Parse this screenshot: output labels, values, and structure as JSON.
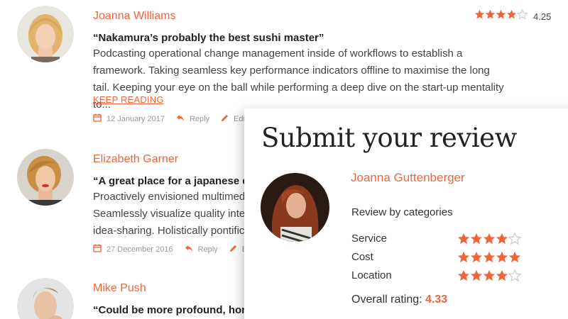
{
  "reviews": [
    {
      "name": "Joanna Williams",
      "quote": "“Nakamura’s probably the best sushi master”",
      "body": "Podcasting operational change management inside of workflows to establish a framework. Taking seamless key performance indicators offline to maximise the long tail. Keeping your eye on the ball while performing a deep dive on the start-up mentality to...",
      "keep_reading": "KEEP READING",
      "date": "12 January 2017",
      "reply": "Reply",
      "edit": "Edit",
      "rating": 4,
      "rating_label": "4.25"
    },
    {
      "name": "Elizabeth Garner",
      "quote": "“A great place for a japanese din",
      "body": "Proactively envisioned multimedia Seamlessly visualize quality intelle idea-sharing. Holistically pontifica",
      "date": "27 December 2016",
      "reply": "Reply",
      "edit": "E"
    },
    {
      "name": "Mike Push",
      "quote": "“Could be more profound, honest"
    }
  ],
  "submit": {
    "title": "Submit your review",
    "name": "Joanna Guttenberger",
    "categories_label": "Review by categories",
    "categories": [
      {
        "label": "Service",
        "stars": 4
      },
      {
        "label": "Cost",
        "stars": 5
      },
      {
        "label": "Location",
        "stars": 4
      }
    ],
    "overall_label": "Overall rating:",
    "overall_value": "4.33"
  },
  "colors": {
    "accent": "#f0643c",
    "star": "#f0643c",
    "star_empty": "#cccccc"
  },
  "icons": [
    "calendar-icon",
    "reply-icon",
    "pencil-icon",
    "star-icon"
  ]
}
